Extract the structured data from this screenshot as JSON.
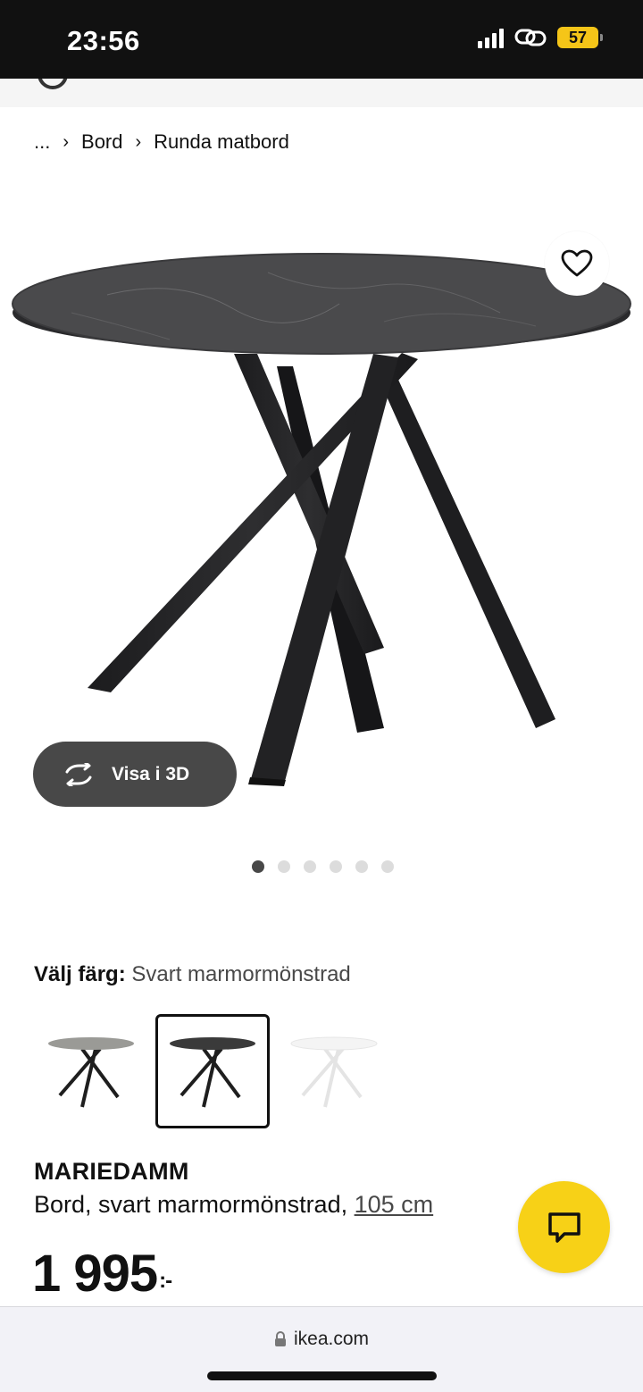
{
  "status_bar": {
    "time": "23:56",
    "battery_level": "57"
  },
  "breadcrumb": {
    "ellipsis": "...",
    "items": [
      "Bord",
      "Runda matbord"
    ]
  },
  "gallery": {
    "view_3d_label": "Visa i 3D",
    "dot_count": 6,
    "active_index": 0
  },
  "color_picker": {
    "label": "Välj färg:",
    "selected_value": "Svart marmormönstrad",
    "swatch_colors": [
      "#9a9a96",
      "#3a3a3a",
      "#f4f4f4"
    ],
    "selected_index": 1
  },
  "product": {
    "name": "MARIEDAMM",
    "description": "Bord, svart marmormönstrad,",
    "size_link": "105 cm",
    "price": "1 995",
    "price_suffix": ":-"
  },
  "browser": {
    "url": "ikea.com"
  },
  "colors": {
    "chat_accent": "#f7d117",
    "dark_button": "#484848"
  }
}
